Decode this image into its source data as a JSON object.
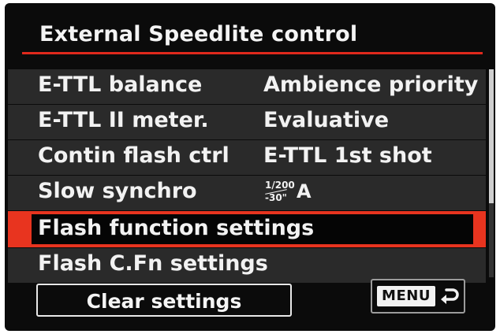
{
  "screen": {
    "title": "External Speedlite control",
    "accent_color": "#e8341f"
  },
  "menu_items": [
    {
      "label": "E-TTL balance",
      "value": "Ambience priority"
    },
    {
      "label": "E-TTL II meter.",
      "value": "Evaluative"
    },
    {
      "label": "Contin flash ctrl",
      "value": "E-TTL 1st shot"
    },
    {
      "label": "Slow synchro",
      "value_top": "1/200",
      "value_bottom": "-30\"",
      "value_suffix": "A"
    },
    {
      "label": "Flash function settings",
      "selected": true
    },
    {
      "label": "Flash C.Fn settings"
    }
  ],
  "footer": {
    "clear_label": "Clear settings",
    "menu_label": "MENU",
    "return_icon": "return-arrow-icon"
  }
}
